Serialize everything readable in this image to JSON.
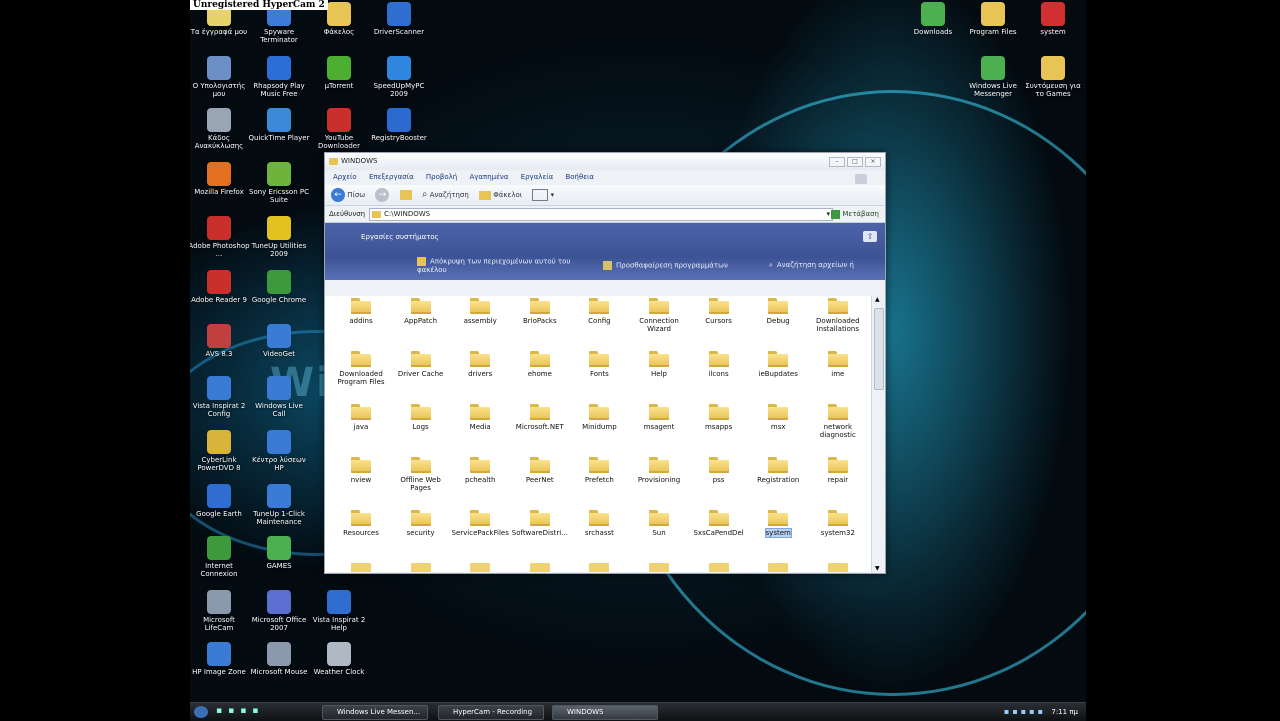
{
  "hypercam_banner": "Unregistered HyperCam 2",
  "desktop_icons_left": [
    {
      "label": "Τα έγγραφά μου",
      "icon": "documents-icon",
      "color": "#e8d36a"
    },
    {
      "label": "Spyware Terminator",
      "icon": "spyware-terminator-icon",
      "color": "#3d7bd9"
    },
    {
      "label": "Φάκελος",
      "icon": "folder-icon",
      "color": "#e8c454"
    },
    {
      "label": "DriverScanner",
      "icon": "driverscanner-icon",
      "color": "#2f6ed0"
    },
    {
      "label": "Ο Υπολογιστής μου",
      "icon": "computer-icon",
      "color": "#6c8fc7"
    },
    {
      "label": "Rhapsody Play Music Free",
      "icon": "rhapsody-icon",
      "color": "#2b6fd6"
    },
    {
      "label": "μTorrent",
      "icon": "utorrent-icon",
      "color": "#4caf32"
    },
    {
      "label": "SpeedUpMyPC 2009",
      "icon": "speedup-icon",
      "color": "#2f86e0"
    },
    {
      "label": "Κάδος Ανακύκλωσης",
      "icon": "recycle-bin-icon",
      "color": "#9aa5b4"
    },
    {
      "label": "QuickTime Player",
      "icon": "quicktime-icon",
      "color": "#3a8ad8"
    },
    {
      "label": "YouTube Downloader",
      "icon": "youtube-downloader-icon",
      "color": "#c9302c"
    },
    {
      "label": "RegistryBooster",
      "icon": "registrybooster-icon",
      "color": "#2d6ad0"
    },
    {
      "label": "Mozilla Firefox",
      "icon": "firefox-icon",
      "color": "#e2701f"
    },
    {
      "label": "Sony Ericsson PC Suite",
      "icon": "sony-ericsson-icon",
      "color": "#6fb43a"
    },
    {
      "label": "Adobe Photoshop ...",
      "icon": "photoshop-icon",
      "color": "#c9302c"
    },
    {
      "label": "TuneUp Utilities 2009",
      "icon": "tuneup-icon",
      "color": "#e2c21f"
    },
    {
      "label": "Adobe Reader 9",
      "icon": "adobe-reader-icon",
      "color": "#c9302c"
    },
    {
      "label": "Google Chrome",
      "icon": "chrome-icon",
      "color": "#3c9a3c"
    },
    {
      "label": "AVS 8.3",
      "icon": "avs-icon",
      "color": "#c04040"
    },
    {
      "label": "VideoGet",
      "icon": "videoget-icon",
      "color": "#3a7bd5"
    },
    {
      "label": "Vista Inspirat 2 Config",
      "icon": "vista-config-icon",
      "color": "#3a7bd5"
    },
    {
      "label": "Windows Live Call",
      "icon": "live-call-icon",
      "color": "#3a7bd5"
    },
    {
      "label": "CyberLink PowerDVD 8",
      "icon": "powerdvd-icon",
      "color": "#d8b43a"
    },
    {
      "label": "Κέντρο λύσεων HP",
      "icon": "hp-solution-center-icon",
      "color": "#3a7bd5"
    },
    {
      "label": "Google Earth",
      "icon": "google-earth-icon",
      "color": "#2f6ed0"
    },
    {
      "label": "TuneUp 1-Click Maintenance",
      "icon": "tuneup-1click-icon",
      "color": "#3a7bd5"
    },
    {
      "label": "Internet Connexion",
      "icon": "internet-connexion-icon",
      "color": "#3c9a3c"
    },
    {
      "label": "GAMES",
      "icon": "games-folder-icon",
      "color": "#4caf50"
    },
    {
      "label": "Microsoft LifeCam",
      "icon": "lifecam-icon",
      "color": "#8a9aac"
    },
    {
      "label": "Microsoft Office 2007",
      "icon": "office-icon",
      "color": "#5c6ed0"
    },
    {
      "label": "Vista Inspirat 2 Help",
      "icon": "help-icon",
      "color": "#2f6ed0"
    },
    {
      "label": "HP Image Zone",
      "icon": "hp-image-zone-icon",
      "color": "#3a7bd5"
    },
    {
      "label": "Microsoft Mouse",
      "icon": "mouse-icon",
      "color": "#8a9aac"
    },
    {
      "label": "Weather Clock",
      "icon": "weather-clock-icon",
      "color": "#b0b8c4"
    }
  ],
  "desktop_icons_right": [
    {
      "label": "Downloads",
      "icon": "downloads-folder-icon",
      "color": "#4caf50"
    },
    {
      "label": "Program Files",
      "icon": "program-files-folder-icon",
      "color": "#e8c454"
    },
    {
      "label": "system",
      "icon": "system-folder-icon",
      "color": "#d03030"
    },
    {
      "label": "Windows Live Messenger",
      "icon": "messenger-icon",
      "color": "#4caf50"
    },
    {
      "label": "Συντόμευση για το Games",
      "icon": "games-shortcut-icon",
      "color": "#e8c454"
    }
  ],
  "window": {
    "title": "WINDOWS",
    "menu": [
      "Αρχείο",
      "Επεξεργασία",
      "Προβολή",
      "Αγαπημένα",
      "Εργαλεία",
      "Βοήθεια"
    ],
    "toolbar": {
      "back": "Πίσω",
      "search": "Αναζήτηση",
      "folders": "Φάκελοι"
    },
    "address_label": "Διεύθυνση",
    "address_value": "C:\\WINDOWS",
    "go_label": "Μετάβαση",
    "tasks_title": "Εργασίες συστήματος",
    "task_items": [
      "Απόκρυψη των περιεχομένων αυτού του φακέλου",
      "Προσθαφαίρεση προγραμμάτων",
      "Αναζήτηση αρχείων ή"
    ],
    "folders": [
      "addins",
      "AppPatch",
      "assembly",
      "BrioPacks",
      "Config",
      "Connection Wizard",
      "Cursors",
      "Debug",
      "Downloaded Installations",
      "Downloaded Program Files",
      "Driver Cache",
      "drivers",
      "ehome",
      "Fonts",
      "Help",
      "ilcons",
      "ieBupdates",
      "ime",
      "java",
      "Logs",
      "Media",
      "Microsoft.NET",
      "Minidump",
      "msagent",
      "msapps",
      "msx",
      "network diagnostic",
      "nview",
      "Offline Web Pages",
      "pchealth",
      "PeerNet",
      "Prefetch",
      "Provisioning",
      "pss",
      "Registration",
      "repair",
      "Resources",
      "security",
      "ServicePackFiles",
      "SoftwareDistri...",
      "srchasst",
      "Sun",
      "SxsCaPendDel",
      "system",
      "system32"
    ],
    "selected_folder": "system"
  },
  "taskbar": {
    "buttons": [
      "Windows Live Messen...",
      "HyperCam - Recording",
      "WINDOWS"
    ],
    "active": "WINDOWS",
    "clock": "7:11 πμ"
  }
}
